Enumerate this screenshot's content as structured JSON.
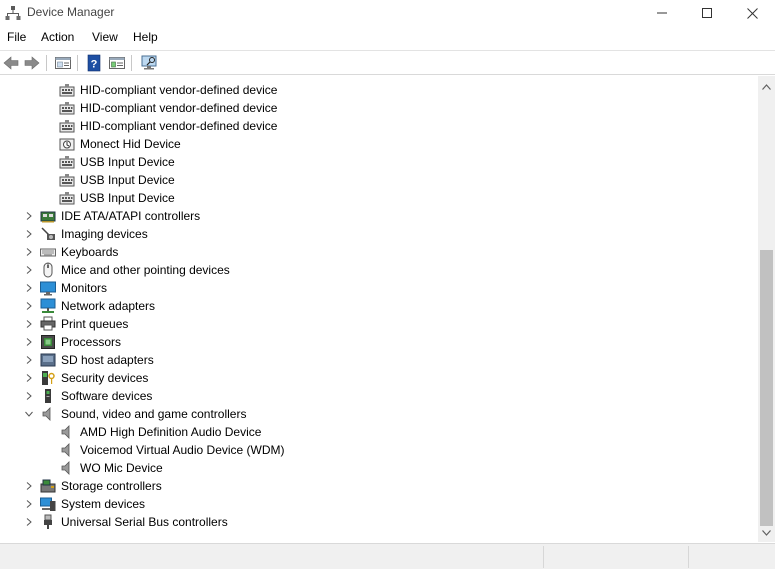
{
  "window": {
    "title": "Device Manager",
    "app_icon": "device-manager-icon"
  },
  "menu": [
    "File",
    "Action",
    "View",
    "Help"
  ],
  "toolbar": {
    "buttons": [
      "back-arrow-icon",
      "forward-arrow-icon",
      "properties-sheet-icon",
      "help-icon",
      "show-hidden-icon",
      "scan-hardware-icon"
    ]
  },
  "tree": {
    "children_above": [
      {
        "label": "HID-compliant vendor-defined device",
        "icon": "hid-device-icon"
      },
      {
        "label": "HID-compliant vendor-defined device",
        "icon": "hid-device-icon"
      },
      {
        "label": "HID-compliant vendor-defined device",
        "icon": "hid-device-icon"
      },
      {
        "label": "Monect Hid Device",
        "icon": "monect-device-icon"
      },
      {
        "label": "USB Input Device",
        "icon": "hid-device-icon"
      },
      {
        "label": "USB Input Device",
        "icon": "hid-device-icon"
      },
      {
        "label": "USB Input Device",
        "icon": "hid-device-icon"
      }
    ],
    "categories_a": [
      {
        "label": "IDE ATA/ATAPI controllers",
        "icon": "ide-controller-icon"
      },
      {
        "label": "Imaging devices",
        "icon": "camera-icon"
      },
      {
        "label": "Keyboards",
        "icon": "keyboard-icon"
      },
      {
        "label": "Mice and other pointing devices",
        "icon": "mouse-icon"
      },
      {
        "label": "Monitors",
        "icon": "monitor-icon"
      },
      {
        "label": "Network adapters",
        "icon": "network-adapter-icon"
      },
      {
        "label": "Print queues",
        "icon": "printer-icon"
      },
      {
        "label": "Processors",
        "icon": "processor-icon"
      },
      {
        "label": "SD host adapters",
        "icon": "sd-card-icon"
      },
      {
        "label": "Security devices",
        "icon": "security-device-icon"
      },
      {
        "label": "Software devices",
        "icon": "software-device-icon"
      }
    ],
    "expanded": {
      "label": "Sound, video and game controllers",
      "icon": "speaker-icon"
    },
    "expanded_children": [
      {
        "label": "AMD High Definition Audio Device",
        "icon": "speaker-icon"
      },
      {
        "label": "Voicemod Virtual Audio Device (WDM)",
        "icon": "speaker-icon"
      },
      {
        "label": "WO Mic Device",
        "icon": "speaker-icon"
      }
    ],
    "categories_b": [
      {
        "label": "Storage controllers",
        "icon": "storage-controller-icon"
      },
      {
        "label": "System devices",
        "icon": "system-devices-icon"
      },
      {
        "label": "Universal Serial Bus controllers",
        "icon": "usb-icon"
      }
    ]
  }
}
